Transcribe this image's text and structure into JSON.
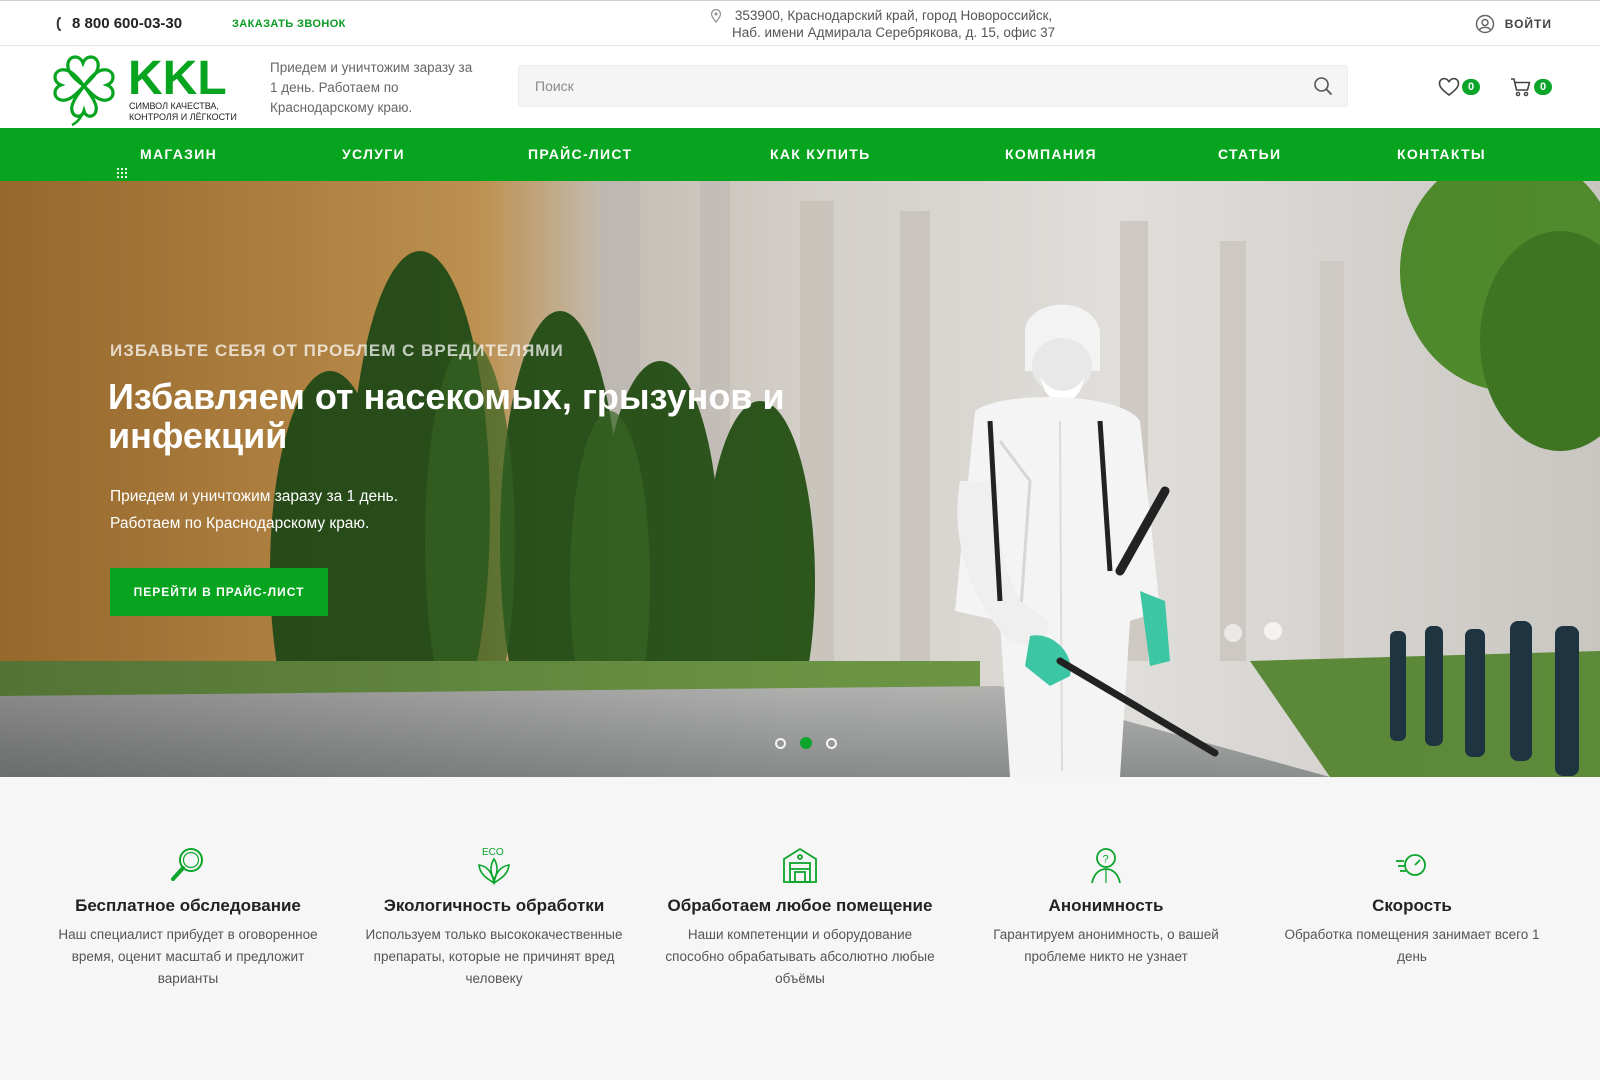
{
  "topbar": {
    "phone": "8 800 600-03-30",
    "callback": "ЗАКАЗАТЬ ЗВОНОК",
    "address_line1": "353900, Краснодарский край, город Новороссийск,",
    "address_line2": "Наб. имени Адмирала Серебрякова, д. 15, офис 37",
    "login": "ВОЙТИ"
  },
  "header": {
    "logo_main": "KKL",
    "logo_line1": "СИМВОЛ КАЧЕСТВА,",
    "logo_line2": "КОНТРОЛЯ И ЛЁГКОСТИ",
    "tagline": "Приедем и уничтожим заразу за 1 день. Работаем по Краснодарскому краю.",
    "search_placeholder": "Поиск",
    "favorites_count": "0",
    "cart_count": "0"
  },
  "nav": {
    "items": [
      "МАГАЗИН",
      "УСЛУГИ",
      "ПРАЙС-ЛИСТ",
      "КАК КУПИТЬ",
      "КОМПАНИЯ",
      "СТАТЬИ",
      "КОНТАКТЫ"
    ]
  },
  "hero": {
    "kicker": "ИЗБАВЬТЕ СЕБЯ ОТ ПРОБЛЕМ С ВРЕДИТЕЛЯМИ",
    "title": "Избавляем от насекомых, грызунов и инфекций",
    "subtitle_line1": "Приедем и уничтожим заразу за 1 день.",
    "subtitle_line2": "Работаем по Краснодарскому краю.",
    "button": "ПЕРЕЙТИ В ПРАЙС-ЛИСТ",
    "slides_total": 3,
    "active_slide": 2
  },
  "features": [
    {
      "icon": "magnifier-icon",
      "title": "Бесплатное обследование",
      "text": "Наш специалист прибудет в оговоренное время, оценит масштаб и предложит варианты"
    },
    {
      "icon": "eco-leaves-icon",
      "eco_label": "ECO",
      "title": "Экологичность обработки",
      "text": "Используем только высококачественные препараты, которые не причинят вред человеку"
    },
    {
      "icon": "warehouse-icon",
      "title": "Обработаем любое помещение",
      "text": "Наши компетенции и оборудование способно обрабатывать абсолютно любые объёмы"
    },
    {
      "icon": "anonymous-person-icon",
      "title": "Анонимность",
      "text": "Гарантируем анонимность, о вашей проблеме никто не узнает"
    },
    {
      "icon": "speed-icon",
      "title": "Скорость",
      "text": "Обработка помещения занимает всего 1 день"
    }
  ],
  "colors": {
    "accent": "#07a51f",
    "badge": "#0aa52a"
  }
}
